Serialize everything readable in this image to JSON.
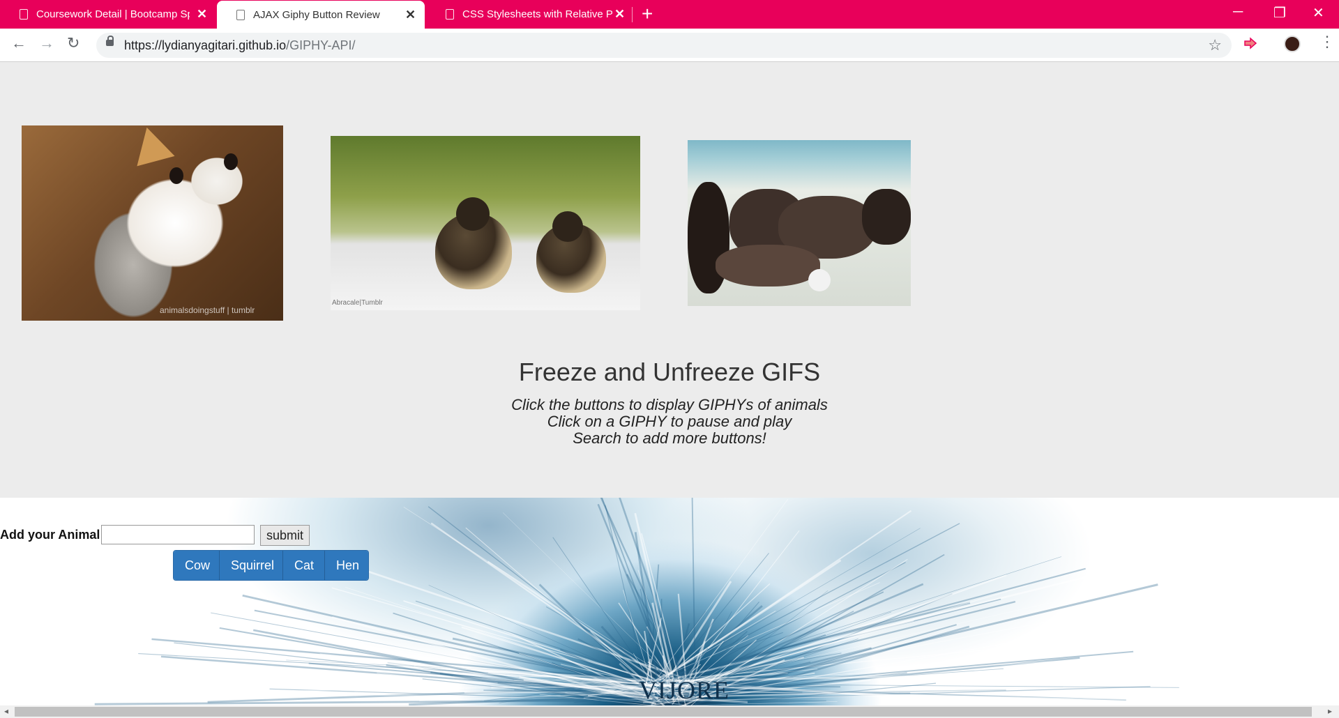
{
  "browser": {
    "tabs": [
      {
        "title": "Coursework Detail | Bootcamp Sp",
        "active": false
      },
      {
        "title": "AJAX Giphy Button Review",
        "active": true
      },
      {
        "title": "CSS Stylesheets with Relative Pat",
        "active": false
      }
    ],
    "tab_close": "✕",
    "new_tab": "+",
    "window_controls": {
      "minimize": "─",
      "restore": "❐",
      "close": "✕"
    },
    "nav": {
      "back": "←",
      "forward": "→",
      "reload": "↻"
    },
    "url_host": "https://lydianyagitari.github.io",
    "url_path": "/GIPHY-API/",
    "bookmark": "☆",
    "menu": "⋮",
    "accent_color": "#e8005a"
  },
  "gifs": [
    {
      "name": "kitten",
      "watermark": "animalsdoingstuff | tumblr"
    },
    {
      "name": "ducklings",
      "watermark": "Abracale|Tumblr"
    },
    {
      "name": "puppies",
      "watermark": ""
    }
  ],
  "heading": "Freeze and Unfreeze GIFS",
  "instructions": [
    "Click the buttons to display GIPHYs of animals",
    "Click on a GIPHY to pause and play",
    "Search to add more buttons!"
  ],
  "form": {
    "label": "Add your Animal",
    "input_value": "",
    "submit_label": "submit"
  },
  "animal_buttons": [
    "Cow",
    "Squirrel",
    "Cat",
    "Hen"
  ],
  "brand": "VIJORE",
  "scroll": {
    "left": "◂",
    "right": "▸"
  }
}
